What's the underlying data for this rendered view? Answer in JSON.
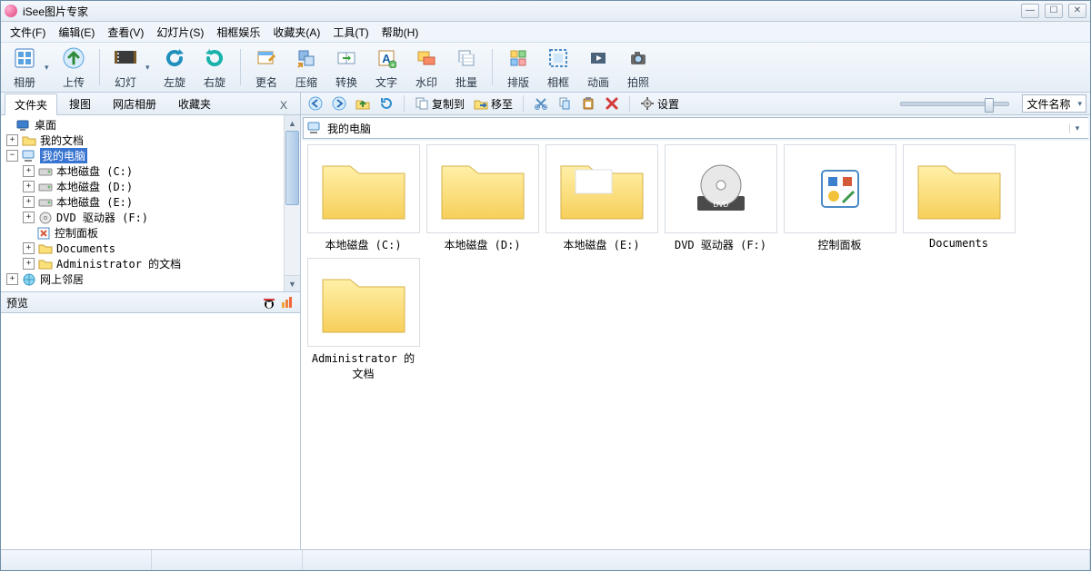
{
  "app": {
    "title": "iSee图片专家"
  },
  "menu": {
    "items": [
      {
        "label": "文件(F)"
      },
      {
        "label": "编辑(E)"
      },
      {
        "label": "查看(V)"
      },
      {
        "label": "幻灯片(S)"
      },
      {
        "label": "相框娱乐"
      },
      {
        "label": "收藏夹(A)"
      },
      {
        "label": "工具(T)"
      },
      {
        "label": "帮助(H)"
      }
    ]
  },
  "toolbar": {
    "album": "相册",
    "upload": "上传",
    "slide": "幻灯",
    "rotl": "左旋",
    "rotr": "右旋",
    "rename": "更名",
    "compress": "压缩",
    "convert": "转换",
    "text": "文字",
    "watermark": "水印",
    "batch": "批量",
    "layout": "排版",
    "frame": "相框",
    "anim": "动画",
    "shoot": "拍照"
  },
  "left": {
    "tabs": {
      "folders": "文件夹",
      "search": "搜图",
      "shop": "网店相册",
      "fav": "收藏夹"
    },
    "tree": {
      "desktop": "桌面",
      "mydocs": "我的文档",
      "mycomputer": "我的电脑",
      "driveC": "本地磁盘 (C:)",
      "driveD": "本地磁盘 (D:)",
      "driveE": "本地磁盘 (E:)",
      "dvdF": "DVD 驱动器 (F:)",
      "cpl": "控制面板",
      "documents": "Documents",
      "admindocs": "Administrator 的文档",
      "network": "网上邻居"
    },
    "preview": "预览"
  },
  "right": {
    "copyto": "复制到",
    "moveto": "移至",
    "settings": "设置",
    "viewmode": "文件名称",
    "breadcrumb": "我的电脑",
    "items": [
      {
        "label": "本地磁盘 (C:)",
        "type": "folder"
      },
      {
        "label": "本地磁盘 (D:)",
        "type": "folder"
      },
      {
        "label": "本地磁盘 (E:)",
        "type": "folder-open"
      },
      {
        "label": "DVD 驱动器 (F:)",
        "type": "dvd"
      },
      {
        "label": "控制面板",
        "type": "cpl"
      },
      {
        "label": "Documents",
        "type": "folder"
      },
      {
        "label": "Administrator 的文档",
        "type": "folder"
      }
    ]
  }
}
